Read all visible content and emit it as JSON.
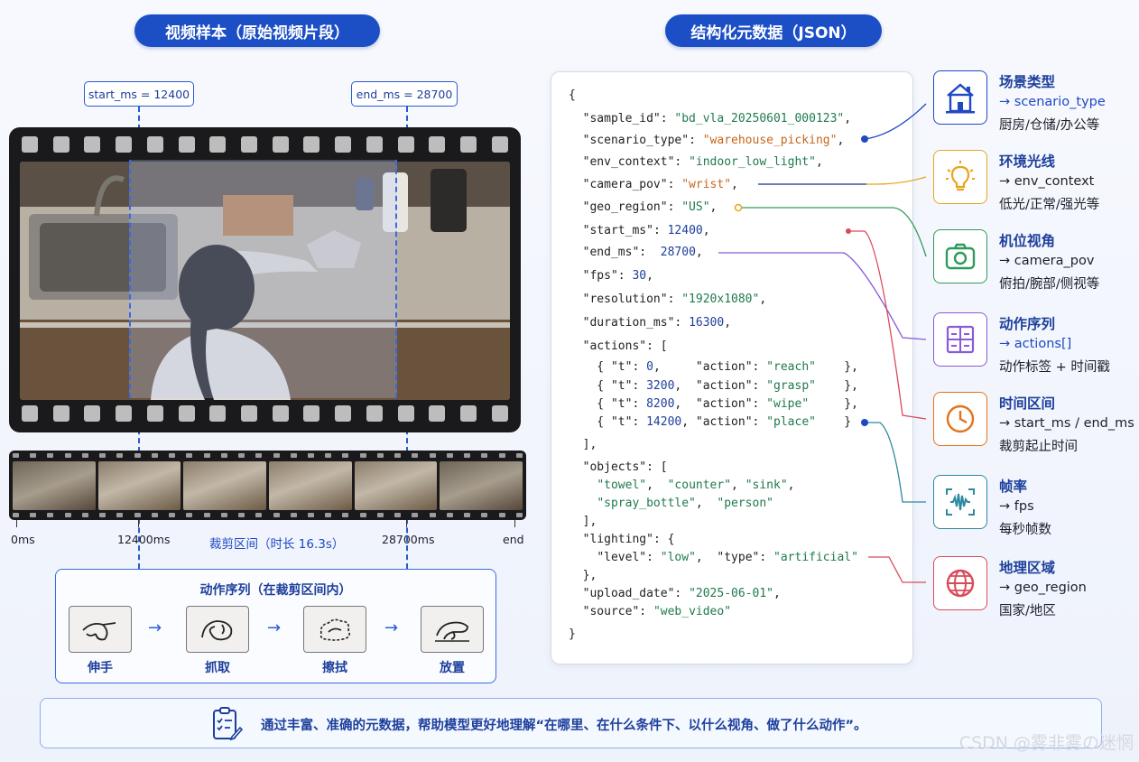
{
  "headers": {
    "video_title": "视频样本（原始视频片段）",
    "json_title": "结构化元数据（JSON）"
  },
  "markers": {
    "start": "start_ms = 12400",
    "end": "end_ms = 28700"
  },
  "timeline": {
    "t0": "0ms",
    "t1": "12400ms",
    "t2": "28700ms",
    "t3": "end",
    "clip_caption": "裁剪区间（时长 16.3s）"
  },
  "action_panel": {
    "title": "动作序列（在裁剪区间内）",
    "actions": [
      "伸手",
      "抓取",
      "擦拭",
      "放置"
    ],
    "arrow": "→"
  },
  "json_lines": [
    "{",
    "  \"sample_id\": \"bd_vla_20250601_000123\",",
    "  \"scenario_type\": \"warehouse_picking\",",
    "  \"env_context\": \"indoor_low_light\",",
    "  \"camera_pov\": \"wrist\",",
    "  \"geo_region\": \"US\",",
    "  \"start_ms\": 12400,",
    "  \"end_ms\":  28700,",
    "  \"fps\": 30,",
    "  \"resolution\": \"1920x1080\",",
    "  \"duration_ms\": 16300,",
    "  \"actions\": [",
    "    { \"t\": 0,     \"action\": \"reach\"    },",
    "    { \"t\": 3200,  \"action\": \"grasp\"    },",
    "    { \"t\": 8200,  \"action\": \"wipe\"     },",
    "    { \"t\": 14200, \"action\": \"place\"    }",
    "  ],",
    "  \"objects\": [",
    "    \"towel\",  \"counter\", \"sink\",",
    "    \"spray_bottle\",  \"person\"",
    "  ],",
    "  \"lighting\": {",
    "    \"level\": \"low\",  \"type\": \"artificial\"",
    "  },",
    "  \"upload_date\": \"2025-06-01\",",
    "  \"source\": \"web_video\"",
    "}"
  ],
  "categories": [
    {
      "title": "场景类型",
      "key": "→ scenario_type",
      "desc": "厨房/仓储/办公等",
      "color": "#1d49c4",
      "icon": "building-icon"
    },
    {
      "title": "环境光线",
      "key": "→ env_context",
      "desc": "低光/正常/强光等",
      "color": "#e8a41c",
      "icon": "lightbulb-icon"
    },
    {
      "title": "机位视角",
      "key": "→ camera_pov",
      "desc": "俯拍/腕部/侧视等",
      "color": "#2f9a5a",
      "icon": "camera-icon"
    },
    {
      "title": "动作序列",
      "key": "→ actions[]",
      "desc": "动作标签 + 时间戳",
      "color": "#8a5ad6",
      "icon": "sequence-icon"
    },
    {
      "title": "时间区间",
      "key": "→ start_ms / end_ms",
      "desc": "裁剪起止时间",
      "color": "#e2731e",
      "icon": "clock-icon"
    },
    {
      "title": "帧率",
      "key": "→ fps",
      "desc": "每秒帧数",
      "color": "#2a8aa0",
      "icon": "waveform-icon"
    },
    {
      "title": "地理区域",
      "key": "→ geo_region",
      "desc": "国家/地区",
      "color": "#d94a5a",
      "icon": "globe-icon"
    }
  ],
  "footer": "通过丰富、准确的元数据，帮助模型更好地理解“在哪里、在什么条件下、以什么视角、做了什么动作”。",
  "watermark": "CSDN @雾非雾の迷惘"
}
